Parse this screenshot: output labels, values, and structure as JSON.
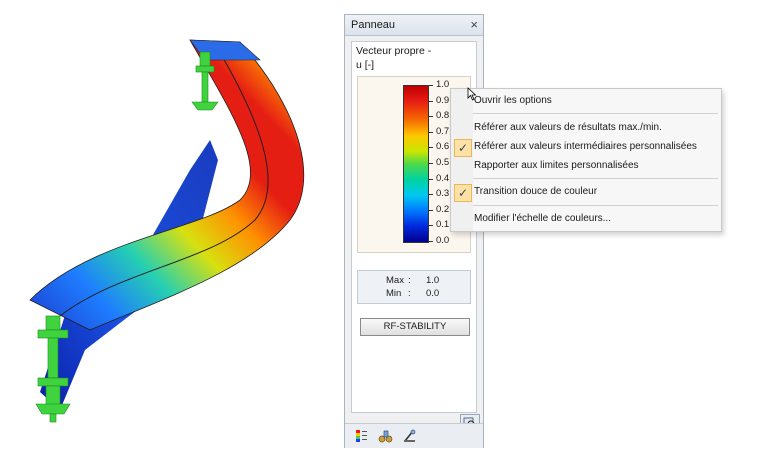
{
  "panel": {
    "title": "Panneau",
    "close_glyph": "×",
    "result_label": "Vecteur propre -",
    "result_unit": "u [-]",
    "legend_ticks": [
      "1.0",
      "0.9",
      "0.8",
      "0.7",
      "0.6",
      "0.5",
      "0.4",
      "0.3",
      "0.2",
      "0.1",
      "0.0"
    ],
    "max_label": "Max",
    "max_value": "1.0",
    "min_label": "Min",
    "min_value": "0.0",
    "separator": ":",
    "stability_button": "RF-STABILITY",
    "tabs": [
      "color-scale-icon",
      "factors-icon",
      "filter-icon"
    ]
  },
  "context_menu": {
    "items": [
      {
        "label": "Ouvrir les options",
        "checked": false
      },
      {
        "label": "Référer aux valeurs de résultats max./min.",
        "checked": false
      },
      {
        "label": "Référer aux valeurs intermédiaires personnalisées",
        "checked": true
      },
      {
        "label": "Rapporter aux limites personnalisées",
        "checked": false
      },
      {
        "label": "Transition douce de couleur",
        "checked": true
      },
      {
        "label": "Modifier l'échelle de couleurs...",
        "checked": false
      }
    ],
    "check_glyph": "✓"
  },
  "colors": {
    "accent_check_bg": "#fce2a8",
    "support_green": "#3fd33f",
    "scale_max": "#c00000",
    "scale_min": "#00008c"
  }
}
